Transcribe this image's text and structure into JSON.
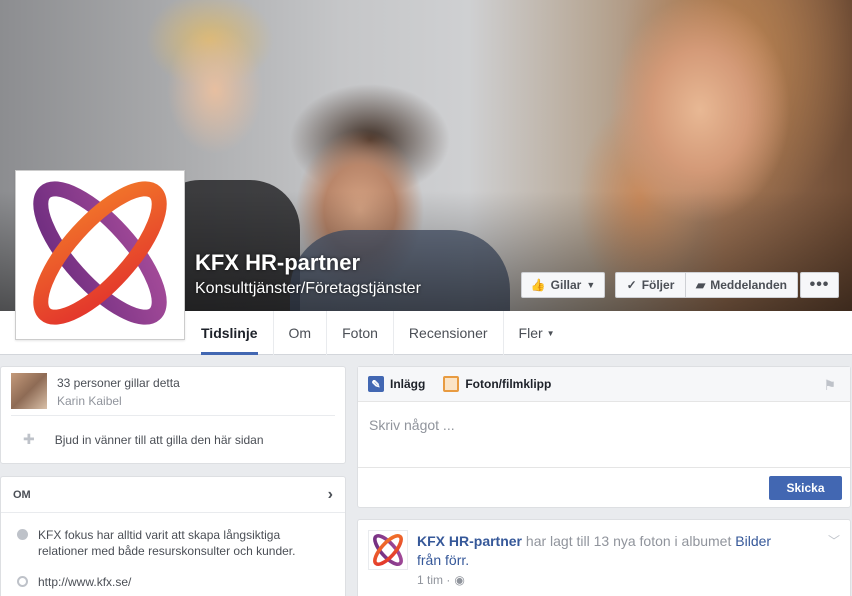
{
  "page": {
    "name": "KFX HR-partner",
    "category": "Konsulttjänster/Företagstjänster"
  },
  "actions": {
    "like_label": "Gillar",
    "follow_label": "Följer",
    "message_label": "Meddelanden",
    "more_label": "•••"
  },
  "nav": {
    "tabs": [
      {
        "label": "Tidslinje"
      },
      {
        "label": "Om"
      },
      {
        "label": "Foton"
      },
      {
        "label": "Recensioner"
      },
      {
        "label": "Fler"
      }
    ]
  },
  "likes": {
    "count_text": "33 personer gillar detta",
    "friend_name": "Karin Kaibel",
    "invite_text": "Bjud in vänner till att gilla den här sidan"
  },
  "about": {
    "title": "OM",
    "description": "KFX fokus har alltid varit att skapa långsiktiga relationer med både resurskonsulter och kunder.",
    "website": "http://www.kfx.se/"
  },
  "composer": {
    "tab_post": "Inlägg",
    "tab_photo": "Foton/filmklipp",
    "placeholder": "Skriv något ...",
    "send_label": "Skicka"
  },
  "story": {
    "actor": "KFX HR-partner",
    "action_text": "har lagt till 13 nya foton i albumet",
    "album_name": "Bilder från förr.",
    "time": "1 tim ·"
  },
  "colors": {
    "brand_blue": "#4267b2",
    "link_blue": "#365899",
    "logo_purple": "#8e3b8f",
    "logo_red": "#e2322c",
    "logo_orange": "#f2772a"
  }
}
